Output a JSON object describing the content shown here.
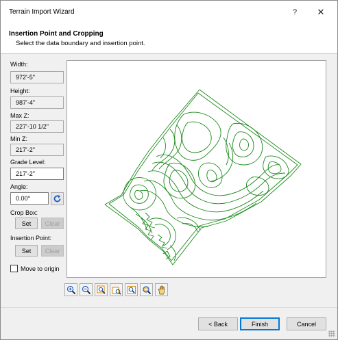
{
  "window": {
    "title": "Terrain Import Wizard",
    "help_glyph": "?",
    "close_glyph": "✕"
  },
  "header": {
    "title": "Insertion Point and Cropping",
    "subtitle": "Select the data boundary and insertion point."
  },
  "fields": {
    "width_label": "Width:",
    "width_value": "972'-5\"",
    "height_label": "Height:",
    "height_value": "987'-4\"",
    "maxz_label": "Max Z:",
    "maxz_value": "227'-10 1/2\"",
    "minz_label": "Min Z:",
    "minz_value": "217'-2\"",
    "grade_label": "Grade Level:",
    "grade_value": "217'-2\"",
    "angle_label": "Angle:",
    "angle_value": "0.00°"
  },
  "crop_box": {
    "label": "Crop Box:",
    "set": "Set",
    "clear": "Clear"
  },
  "insertion_point": {
    "label": "Insertion Point:",
    "set": "Set",
    "clear": "Clear"
  },
  "move_to_origin": {
    "label": "Move to origin",
    "checked": false
  },
  "preview": {
    "contour_color": "#1a8a1a"
  },
  "toolbar": {
    "tools": [
      "zoom-in-icon",
      "zoom-out-icon",
      "zoom-window-icon",
      "zoom-previous-icon",
      "zoom-extents-icon",
      "zoom-fit-icon",
      "pan-hand-icon"
    ]
  },
  "buttons": {
    "back": "< Back",
    "finish": "Finish",
    "cancel": "Cancel"
  },
  "colors": {
    "accent": "#0078d7",
    "contour": "#1a8a1a",
    "window_bg": "#f0f0f0"
  }
}
